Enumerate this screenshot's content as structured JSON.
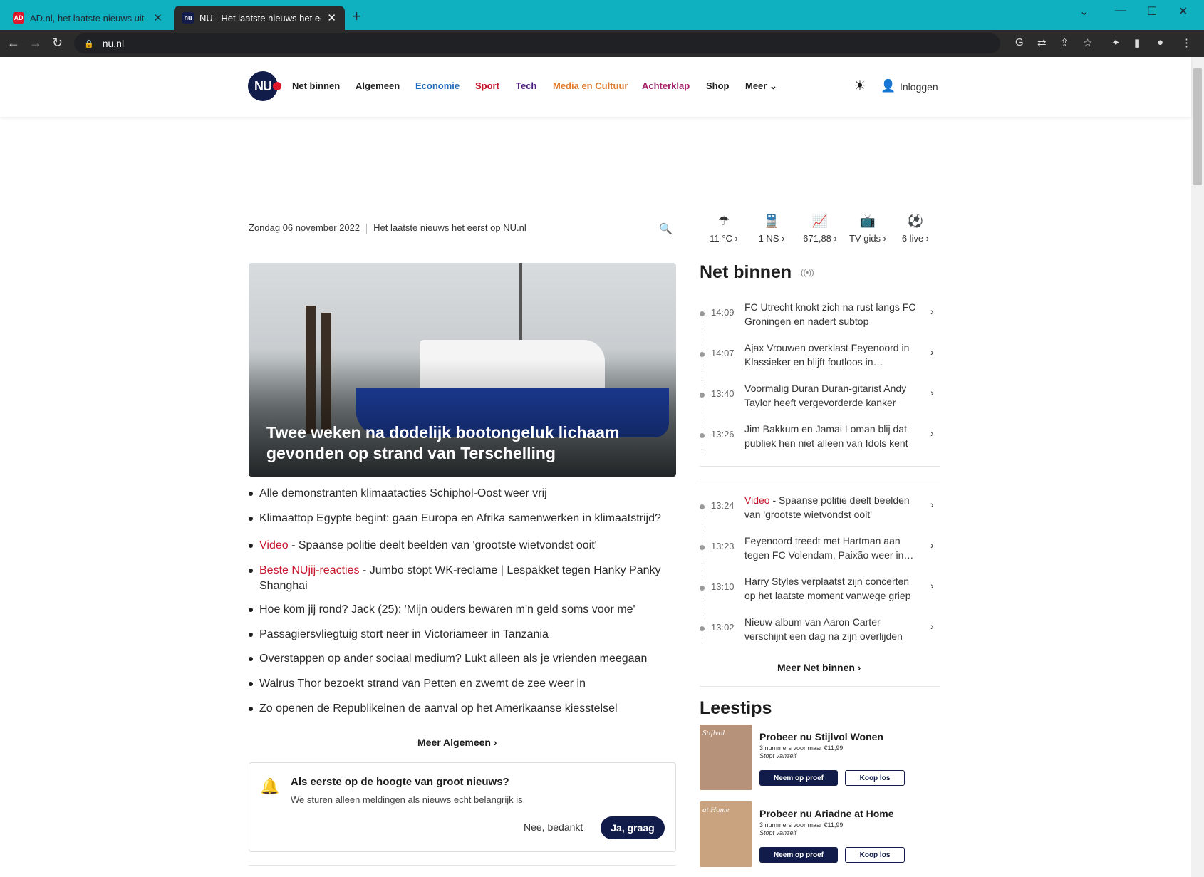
{
  "browser": {
    "tabs": [
      {
        "title": "AD.nl, het laatste nieuws uit binn",
        "favicon": "AD"
      },
      {
        "title": "NU - Het laatste nieuws het eerst",
        "favicon": "nu"
      }
    ],
    "url": "nu.nl",
    "colors": {
      "tabstrip": "#0fb1c0",
      "toolbar": "#2b2b2b"
    }
  },
  "site": {
    "logo": "NU",
    "nav": [
      {
        "label": "Net binnen",
        "color": "#1d1d1d"
      },
      {
        "label": "Algemeen",
        "color": "#1d1d1d"
      },
      {
        "label": "Economie",
        "color": "#1f6bbd"
      },
      {
        "label": "Sport",
        "color": "#c6162b"
      },
      {
        "label": "Tech",
        "color": "#4b1d7a"
      },
      {
        "label": "Media en Cultuur",
        "color": "#e07b2c"
      },
      {
        "label": "Achterklap",
        "color": "#a3236b"
      },
      {
        "label": "Shop",
        "color": "#1d1d1d"
      },
      {
        "label": "Meer ⌄",
        "color": "#1d1d1d"
      }
    ],
    "login": "Inloggen",
    "date": "Zondag 06 november 2022",
    "tagline": "Het laatste nieuws het eerst op NU.nl"
  },
  "hero": {
    "title": "Twee weken na dodelijk bootongeluk lichaam gevonden op strand van Terschelling"
  },
  "headlines": [
    {
      "tag": "",
      "text": "Alle demonstranten klimaatacties Schiphol-Oost weer vrij"
    },
    {
      "tag": "",
      "text": "Klimaattop Egypte begint: gaan Europa en Afrika samenwerken in klimaatstrijd?"
    },
    {
      "tag": "Video",
      "text": "Spaanse politie deelt beelden van 'grootste wietvondst ooit'"
    },
    {
      "tag": "Beste NUjij-reacties",
      "text": "Jumbo stopt WK-reclame | Lespakket tegen Hanky Panky Shanghai"
    },
    {
      "tag": "",
      "text": "Hoe kom jij rond? Jack (25): 'Mijn ouders bewaren m'n geld soms voor me'"
    },
    {
      "tag": "",
      "text": "Passagiersvliegtuig stort neer in Victoriameer in Tanzania"
    },
    {
      "tag": "",
      "text": "Overstappen op ander sociaal medium? Lukt alleen als je vrienden meegaan"
    },
    {
      "tag": "",
      "text": "Walrus Thor bezoekt strand van Petten en zwemt de zee weer in"
    },
    {
      "tag": "",
      "text": "Zo openen de Republikeinen de aanval op het Amerikaanse kiesstelsel"
    }
  ],
  "meer_algemeen": "Meer Algemeen ›",
  "notify": {
    "title": "Als eerste op de hoogte van groot nieuws?",
    "text": "We sturen alleen meldingen als nieuws echt belangrijk is.",
    "no": "Nee, bedankt",
    "yes": "Ja, graag"
  },
  "widgets": [
    {
      "icon": "weather-icon",
      "label": "11 °C ›"
    },
    {
      "icon": "train-icon",
      "label": "1 NS ›"
    },
    {
      "icon": "stocks-icon",
      "label": "671,88 ›"
    },
    {
      "icon": "tv-icon",
      "label": "TV gids ›"
    },
    {
      "icon": "live-icon",
      "label": "6 live ›"
    }
  ],
  "net_binnen": {
    "title": "Net binnen",
    "group1": [
      {
        "time": "14:09",
        "tag": "",
        "text": "FC Utrecht knokt zich na rust langs FC Groningen en nadert subtop"
      },
      {
        "time": "14:07",
        "tag": "",
        "text": "Ajax Vrouwen overklast Feyenoord in Klassieker en blijft foutloos in…"
      },
      {
        "time": "13:40",
        "tag": "",
        "text": "Voormalig Duran Duran-gitarist Andy Taylor heeft vergevorderde kanker"
      },
      {
        "time": "13:26",
        "tag": "",
        "text": "Jim Bakkum en Jamai Loman blij dat publiek hen niet alleen van Idols kent"
      }
    ],
    "group2": [
      {
        "time": "13:24",
        "tag": "Video",
        "text": "Spaanse politie deelt beelden van 'grootste wietvondst ooit'"
      },
      {
        "time": "13:23",
        "tag": "",
        "text": "Feyenoord treedt met Hartman aan tegen FC Volendam, Paixão weer in…"
      },
      {
        "time": "13:10",
        "tag": "",
        "text": "Harry Styles verplaatst zijn concerten op het laatste moment vanwege griep"
      },
      {
        "time": "13:02",
        "tag": "",
        "text": "Nieuw album van Aaron Carter verschijnt een dag na zijn overlijden"
      }
    ],
    "more": "Meer Net binnen ›"
  },
  "leestips": {
    "title": "Leestips",
    "offers": [
      {
        "title": "Probeer nu Stijlvol Wonen",
        "price": "3 nummers voor maar €11,99",
        "note": "Stopt vanzelf",
        "btn1": "Neem op proef",
        "btn2": "Koop los",
        "mag_title": "Stijlvol",
        "cover": "#b7927a"
      },
      {
        "title": "Probeer nu Ariadne at Home",
        "price": "3 nummers voor maar €11,99",
        "note": "Stopt vanzelf",
        "btn1": "Neem op proef",
        "btn2": "Koop los",
        "mag_title": "at Home",
        "cover": "#c9a37f"
      }
    ]
  }
}
